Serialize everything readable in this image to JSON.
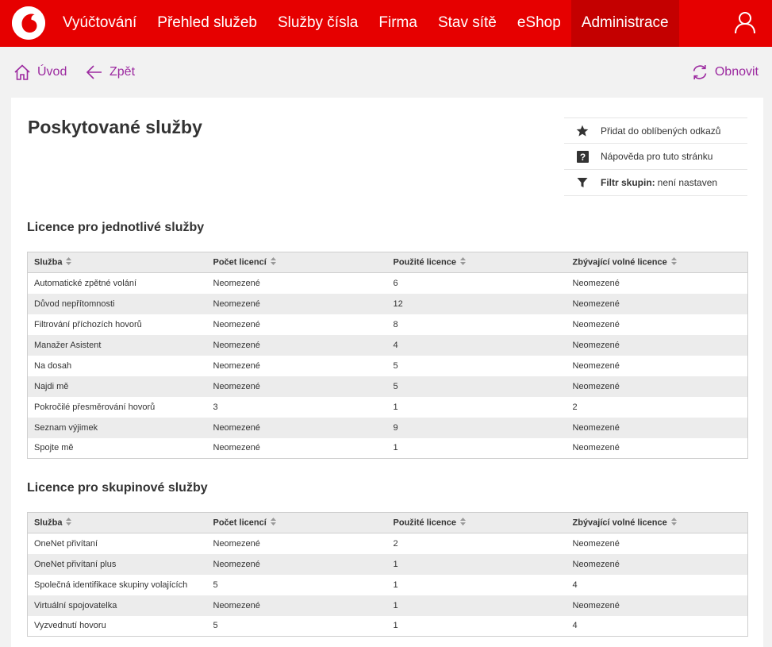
{
  "colors": {
    "brand": "#e60000",
    "brand_active": "#c40000",
    "link": "#9c2aa0"
  },
  "nav": {
    "items": [
      {
        "label": "Vyúčtování"
      },
      {
        "label": "Přehled služeb"
      },
      {
        "label": "Služby čísla"
      },
      {
        "label": "Firma"
      },
      {
        "label": "Stav sítě"
      },
      {
        "label": "eShop"
      },
      {
        "label": "Administrace"
      }
    ],
    "active": "Administrace"
  },
  "toolbar": {
    "home_label": "Úvod",
    "back_label": "Zpět",
    "refresh_label": "Obnovit"
  },
  "page": {
    "title": "Poskytované služby"
  },
  "actions": {
    "favorite": "Přidat do oblíbených odkazů",
    "help": "Nápověda pro tuto stránku",
    "filter_label": "Filtr skupin:",
    "filter_value": "není nastaven"
  },
  "columns": [
    "Služba",
    "Počet licencí",
    "Použité licence",
    "Zbývající volné licence"
  ],
  "individual": {
    "title": "Licence pro jednotlivé služby",
    "rows": [
      [
        "Automatické zpětné volání",
        "Neomezené",
        "6",
        "Neomezené"
      ],
      [
        "Důvod nepřítomnosti",
        "Neomezené",
        "12",
        "Neomezené"
      ],
      [
        "Filtrování příchozích hovorů",
        "Neomezené",
        "8",
        "Neomezené"
      ],
      [
        "Manažer Asistent",
        "Neomezené",
        "4",
        "Neomezené"
      ],
      [
        "Na dosah",
        "Neomezené",
        "5",
        "Neomezené"
      ],
      [
        "Najdi mě",
        "Neomezené",
        "5",
        "Neomezené"
      ],
      [
        "Pokročilé přesměrování hovorů",
        "3",
        "1",
        "2"
      ],
      [
        "Seznam výjimek",
        "Neomezené",
        "9",
        "Neomezené"
      ],
      [
        "Spojte mě",
        "Neomezené",
        "1",
        "Neomezené"
      ]
    ]
  },
  "group": {
    "title": "Licence pro skupinové služby",
    "rows": [
      [
        "OneNet přivítaní",
        "Neomezené",
        "2",
        "Neomezené"
      ],
      [
        "OneNet přivítaní plus",
        "Neomezené",
        "1",
        "Neomezené"
      ],
      [
        "Společná identifikace skupiny volajících",
        "5",
        "1",
        "4"
      ],
      [
        "Virtuální spojovatelka",
        "Neomezené",
        "1",
        "Neomezené"
      ],
      [
        "Vyzvednutí hovoru",
        "5",
        "1",
        "4"
      ]
    ]
  }
}
